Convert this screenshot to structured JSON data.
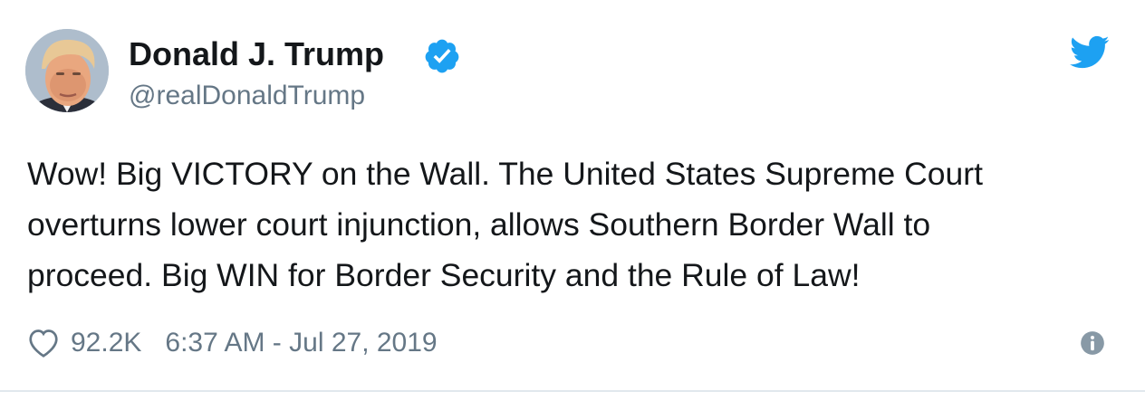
{
  "author": {
    "display_name": "Donald J. Trump",
    "handle": "@realDonaldTrump",
    "verified_icon": "verified-badge-icon"
  },
  "tweet": {
    "lines": [
      "Wow! Big VICTORY on the Wall. The United States Supreme Court",
      "overturns lower court injunction, allows Southern Border Wall to",
      "proceed. Big WIN for Border Security and the Rule of Law!"
    ]
  },
  "footer": {
    "likes": "92.2K",
    "timestamp": "6:37 AM - Jul 27, 2019"
  },
  "icons": {
    "brand": "twitter-bird-icon",
    "like": "heart-icon",
    "info": "info-icon"
  },
  "colors": {
    "twitter_blue": "#1da1f2",
    "text": "#14171a",
    "secondary": "#657786",
    "border": "#e1e8ed"
  }
}
